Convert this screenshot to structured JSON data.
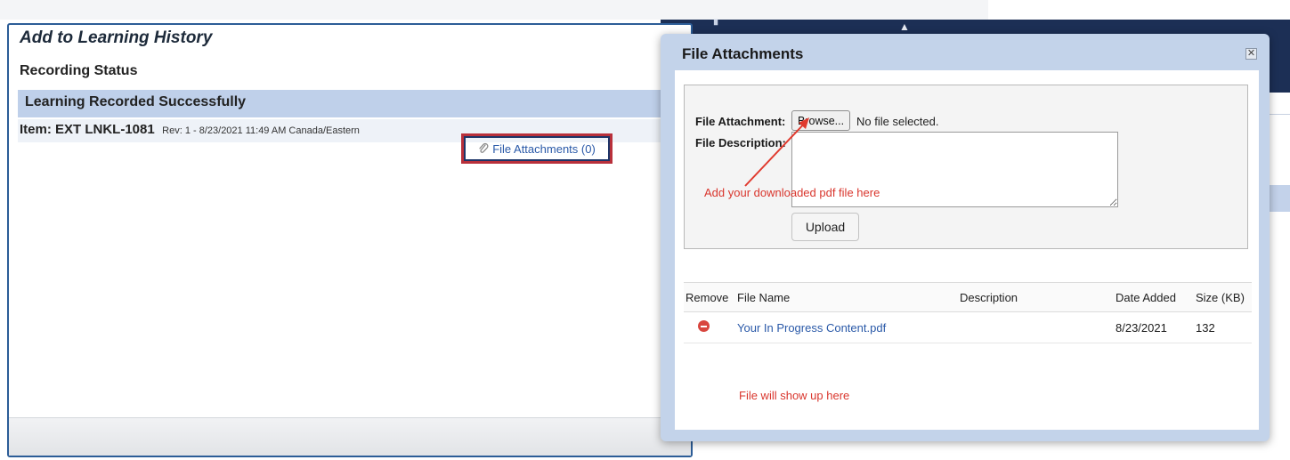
{
  "learning_history": {
    "title": "Add to Learning History",
    "status_heading": "Recording Status",
    "success_message": "Learning Recorded Successfully",
    "item_code": "Item: EXT LNKL-1081",
    "item_meta": "Rev: 1 - 8/23/2021 11:49 AM Canada/Eastern",
    "attachments_link": "File Attachments (0)"
  },
  "modal": {
    "title": "File Attachments",
    "close_label": "✕",
    "file_attachment_label": "File Attachment:",
    "browse_label": "Browse...",
    "no_file_text": "No file selected.",
    "file_description_label": "File Description:",
    "upload_label": "Upload",
    "hint_add": "Add your downloaded pdf file here",
    "hint_show": "File will show up here",
    "table": {
      "columns": [
        "Remove",
        "File Name",
        "Description",
        "Date Added",
        "Size (KB)"
      ],
      "rows": [
        {
          "file_name": "Your In Progress Content.pdf",
          "description": "",
          "date_added": "8/23/2021",
          "size_kb": "132"
        }
      ]
    }
  },
  "colors": {
    "panel_border": "#2c5d97",
    "success_bar": "#bfd0ea",
    "modal_frame": "#c3d3ea",
    "header_dark": "#1c2f55",
    "link": "#2a59a8",
    "highlight_red": "#b8303b",
    "annotation_red": "#d9362d"
  },
  "icons": [
    "paperclip-icon",
    "close-icon",
    "remove-icon",
    "annotation-arrow-icon"
  ]
}
